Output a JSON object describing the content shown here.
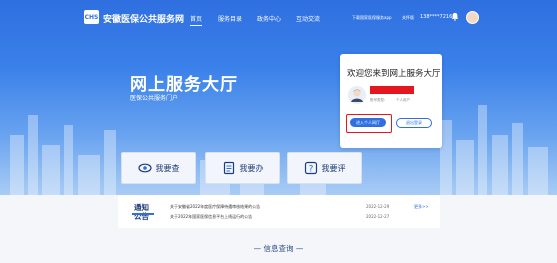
{
  "header": {
    "logo_text": "CHS",
    "site_title": "安徽医保公共服务网",
    "nav": [
      {
        "label": "首页",
        "active": true
      },
      {
        "label": "服务目录",
        "active": false
      },
      {
        "label": "政务中心",
        "active": false
      },
      {
        "label": "互动交流",
        "active": false
      }
    ],
    "download_app": "下载国家医保服务app",
    "care_mode": "关怀版",
    "phone": "138****7216",
    "bell_icon": "bell-icon"
  },
  "hero": {
    "title": "网上服务大厅",
    "subtitle": "医保公共服务门户"
  },
  "user_card": {
    "welcome": "欢迎您来到网上服务大厅",
    "meta_type": "账号类型:",
    "meta_role": "个人用户",
    "enter_button": "进入个人网厅",
    "logout_button": "退出登录",
    "redaction_color": "#e5161f"
  },
  "services": [
    {
      "label": "我要查",
      "icon": "eye-icon"
    },
    {
      "label": "我要办",
      "icon": "document-icon"
    },
    {
      "label": "我要评",
      "icon": "question-icon"
    }
  ],
  "notice": {
    "title_line1": "通知",
    "title_line2": "公告",
    "more": "更多>>",
    "items": [
      {
        "text": "关于安徽省2022年度医疗保障待遇审核结果的公告",
        "date": "2022-12-29"
      },
      {
        "text": "关于2022年国家医保信息平台上线运行的公告",
        "date": "2022-12-27"
      }
    ]
  },
  "info_query": {
    "title": "— 信息查询 —"
  },
  "colors": {
    "primary": "#2f6fe0",
    "navy": "#1f3c78",
    "highlight": "#e5161f"
  }
}
